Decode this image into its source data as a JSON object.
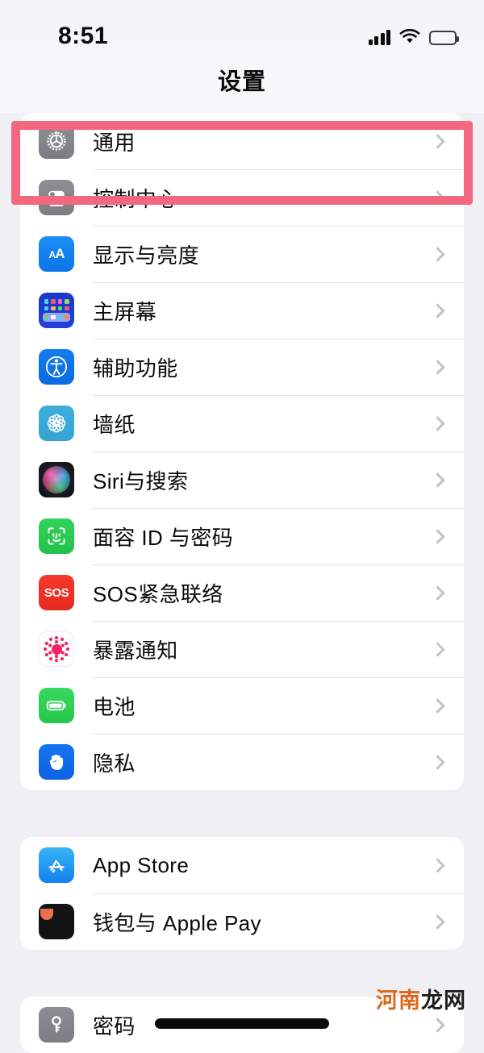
{
  "status_bar": {
    "time": "8:51",
    "cellular_icon": "signal-bars-icon",
    "wifi_icon": "wifi-icon",
    "battery_icon": "battery-icon"
  },
  "nav": {
    "title": "设置"
  },
  "highlight": {
    "color": "#F4687F",
    "target": "通用"
  },
  "groups": [
    {
      "rows": [
        {
          "label": "通用",
          "icon": "gear-icon",
          "chevron": "chevron-right-icon",
          "highlighted": true
        },
        {
          "label": "控制中心",
          "icon": "control-center-icon",
          "chevron": "chevron-right-icon"
        },
        {
          "label": "显示与亮度",
          "icon": "display-brightness-icon",
          "chevron": "chevron-right-icon"
        },
        {
          "label": "主屏幕",
          "icon": "home-screen-icon",
          "chevron": "chevron-right-icon"
        },
        {
          "label": "辅助功能",
          "icon": "accessibility-icon",
          "chevron": "chevron-right-icon"
        },
        {
          "label": "墙纸",
          "icon": "wallpaper-icon",
          "chevron": "chevron-right-icon"
        },
        {
          "label": "Siri与搜索",
          "icon": "siri-icon",
          "chevron": "chevron-right-icon"
        },
        {
          "label": "面容 ID 与密码",
          "icon": "face-id-icon",
          "chevron": "chevron-right-icon"
        },
        {
          "label": "SOS紧急联络",
          "icon": "sos-icon",
          "chevron": "chevron-right-icon"
        },
        {
          "label": "暴露通知",
          "icon": "exposure-notification-icon",
          "chevron": "chevron-right-icon"
        },
        {
          "label": "电池",
          "icon": "battery-settings-icon",
          "chevron": "chevron-right-icon"
        },
        {
          "label": "隐私",
          "icon": "privacy-hand-icon",
          "chevron": "chevron-right-icon"
        }
      ]
    },
    {
      "rows": [
        {
          "label": "App Store",
          "icon": "app-store-icon",
          "chevron": "chevron-right-icon"
        },
        {
          "label": "钱包与 Apple Pay",
          "icon": "wallet-icon",
          "chevron": "chevron-right-icon"
        }
      ]
    },
    {
      "rows": [
        {
          "label": "密码",
          "icon": "password-key-icon",
          "chevron": "chevron-right-icon"
        }
      ]
    }
  ],
  "watermark": {
    "part1": "河南",
    "part2": "龙网",
    "color1": "#E2661A",
    "color2": "#1d1d1d"
  },
  "home_indicator": "home-indicator-bar"
}
